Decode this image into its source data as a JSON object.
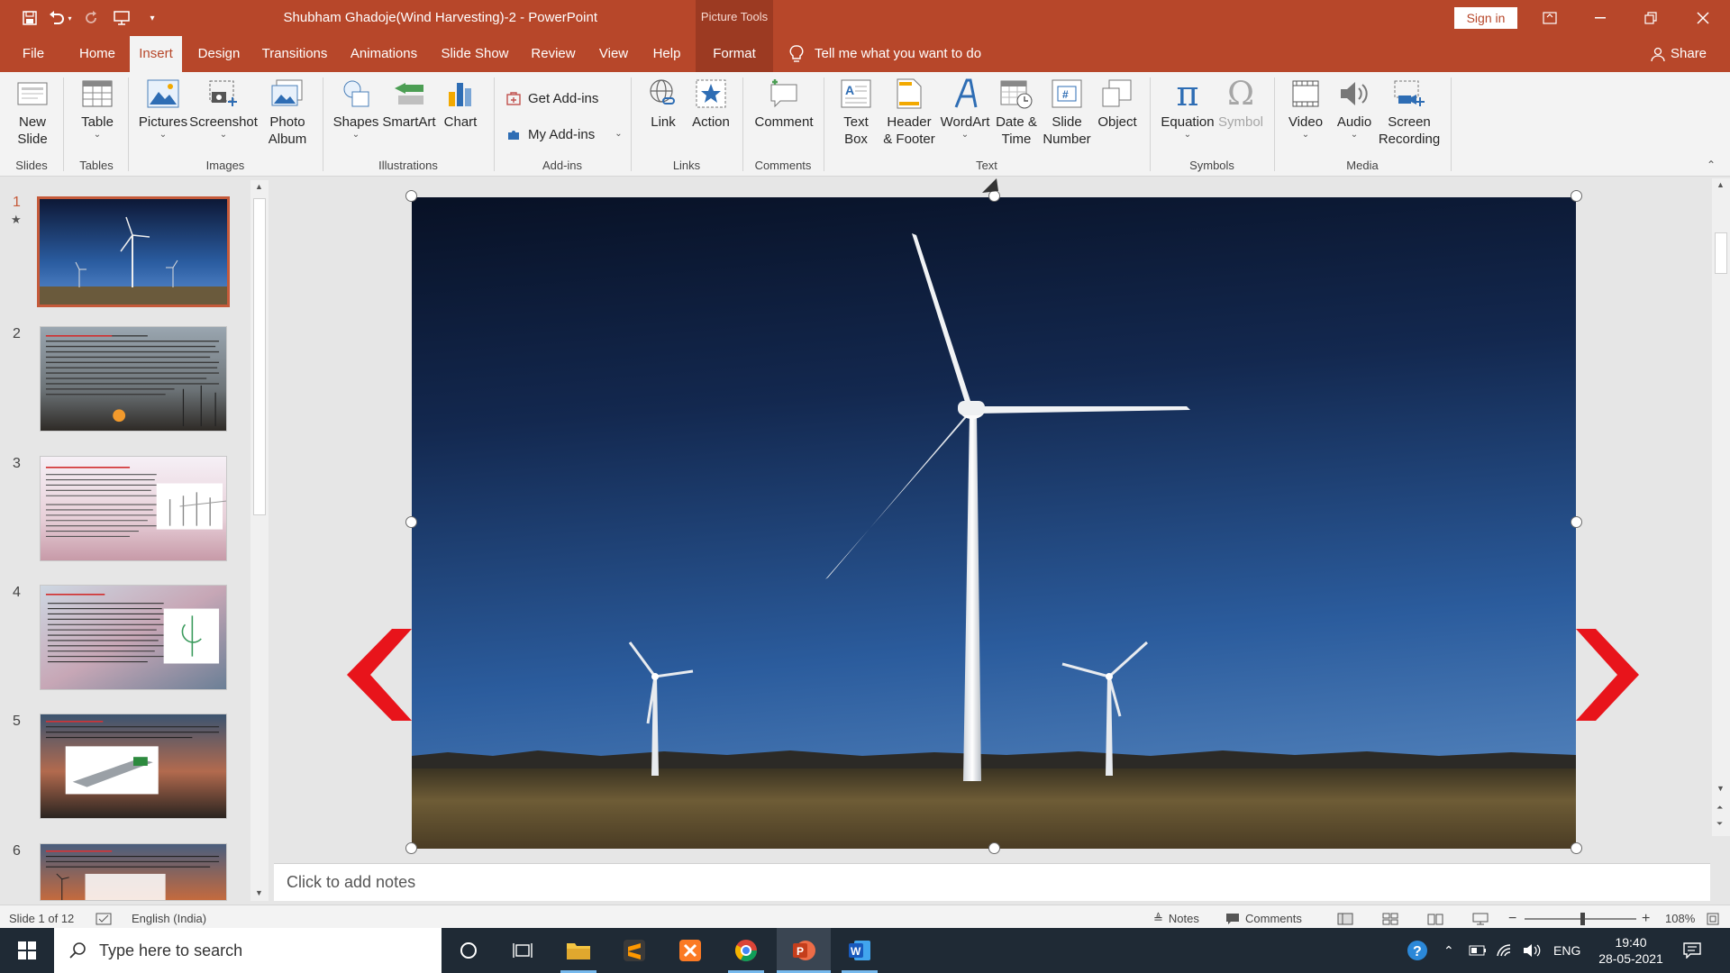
{
  "window": {
    "title": "Shubham Ghadoje(Wind Harvesting)-2 - PowerPoint",
    "picture_tools_label": "Picture Tools",
    "sign_in": "Sign in"
  },
  "tabs": [
    "File",
    "Home",
    "Insert",
    "Design",
    "Transitions",
    "Animations",
    "Slide Show",
    "Review",
    "View",
    "Help",
    "Format"
  ],
  "active_tab": "Insert",
  "tell_me": "Tell me what you want to do",
  "share": "Share",
  "ribbon": {
    "slides": {
      "new_slide_1": "New",
      "new_slide_2": "Slide",
      "group": "Slides"
    },
    "tables": {
      "table": "Table",
      "group": "Tables"
    },
    "images": {
      "pictures": "Pictures",
      "screenshot": "Screenshot",
      "photo_album_1": "Photo",
      "photo_album_2": "Album",
      "group": "Images"
    },
    "illustrations": {
      "shapes": "Shapes",
      "smartart": "SmartArt",
      "chart": "Chart",
      "group": "Illustrations"
    },
    "addins": {
      "get": "Get Add-ins",
      "my": "My Add-ins",
      "group": "Add-ins"
    },
    "links": {
      "link": "Link",
      "action": "Action",
      "group": "Links"
    },
    "comments": {
      "comment": "Comment",
      "group": "Comments"
    },
    "text": {
      "textbox_1": "Text",
      "textbox_2": "Box",
      "header_1": "Header",
      "header_2": "& Footer",
      "wordart": "WordArt",
      "datetime_1": "Date &",
      "datetime_2": "Time",
      "slidenum_1": "Slide",
      "slidenum_2": "Number",
      "object": "Object",
      "group": "Text"
    },
    "symbols": {
      "equation": "Equation",
      "symbol": "Symbol",
      "group": "Symbols"
    },
    "media": {
      "video": "Video",
      "audio": "Audio",
      "screen_1": "Screen",
      "screen_2": "Recording",
      "group": "Media"
    }
  },
  "slides": [
    {
      "num": "1"
    },
    {
      "num": "2"
    },
    {
      "num": "3"
    },
    {
      "num": "4"
    },
    {
      "num": "5"
    },
    {
      "num": "6"
    }
  ],
  "notes_placeholder": "Click to add notes",
  "status": {
    "slide_of": "Slide 1 of 12",
    "language": "English (India)",
    "notes": "Notes",
    "comments": "Comments",
    "zoom": "108%"
  },
  "taskbar": {
    "search_placeholder": "Type here to search",
    "lang": "ENG",
    "time": "19:40",
    "date": "28-05-2021"
  },
  "colors": {
    "accent": "#b7472a",
    "arrow_red": "#e8141b"
  }
}
